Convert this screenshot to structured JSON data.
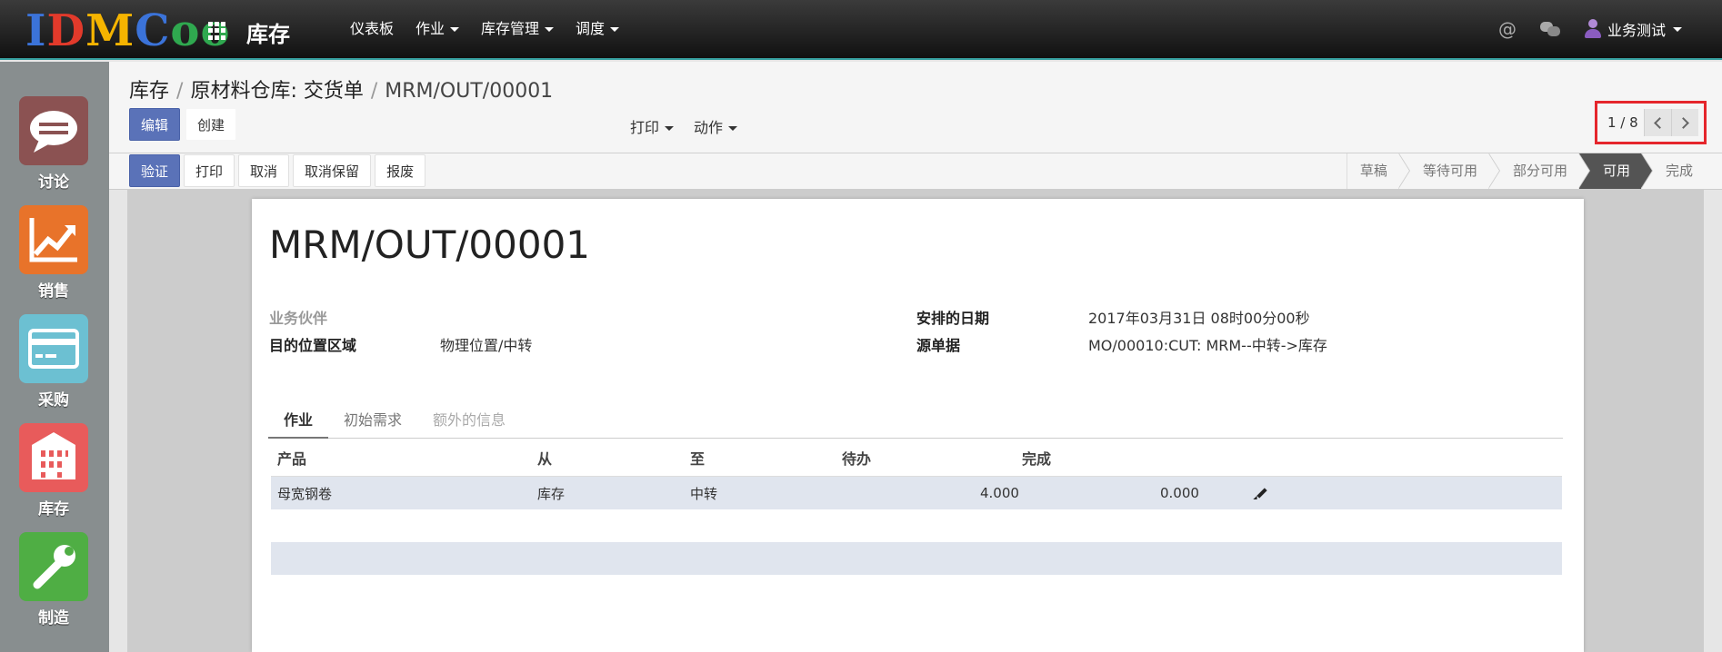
{
  "navbar": {
    "logo": [
      "I",
      "D",
      "M",
      "C",
      "o",
      "o"
    ],
    "logo_colors": [
      "#3b73d9",
      "#e23a2b",
      "#f5b400",
      "#3b73d9",
      "#2fa84f",
      "#2fa84f"
    ],
    "app_title": "库存",
    "menu": [
      {
        "label": "仪表板",
        "dropdown": false
      },
      {
        "label": "作业",
        "dropdown": true
      },
      {
        "label": "库存管理",
        "dropdown": true
      },
      {
        "label": "调度",
        "dropdown": true
      }
    ],
    "at_symbol": "@",
    "user_name": "业务测试"
  },
  "sidebar": {
    "apps": [
      {
        "label": "讨论",
        "color": "#8b5252",
        "icon": "chat-bubble-icon"
      },
      {
        "label": "销售",
        "color": "#e8732a",
        "icon": "trending-up-chart-icon"
      },
      {
        "label": "采购",
        "color": "#6cc0d2",
        "icon": "credit-card-icon"
      },
      {
        "label": "库存",
        "color": "#e85b5b",
        "icon": "building-icon"
      },
      {
        "label": "制造",
        "color": "#4fae44",
        "icon": "wrench-icon"
      }
    ]
  },
  "breadcrumb": {
    "items": [
      "库存",
      "原材料仓库: 交货单"
    ],
    "current": "MRM/OUT/00001"
  },
  "control": {
    "edit_label": "编辑",
    "create_label": "创建",
    "print_label": "打印",
    "action_label": "动作",
    "pager_value": "1 / 8"
  },
  "statusbar": {
    "buttons": [
      "验证",
      "打印",
      "取消",
      "取消保留",
      "报废"
    ],
    "stages": [
      "草稿",
      "等待可用",
      "部分可用",
      "可用",
      "完成"
    ],
    "current_stage": "可用"
  },
  "form": {
    "title": "MRM/OUT/00001",
    "partner_label": "业务伙伴",
    "partner_value": "",
    "dest_label": "目的位置区域",
    "dest_value": "物理位置/中转",
    "scheduled_label": "安排的日期",
    "scheduled_value": "2017年03月31日 08时00分00秒",
    "origin_label": "源单据",
    "origin_value": "MO/00010:CUT: MRM--中转->库存",
    "tabs": [
      "作业",
      "初始需求",
      "额外的信息"
    ],
    "active_tab": "作业"
  },
  "table": {
    "columns": [
      "产品",
      "从",
      "至",
      "待办",
      "完成"
    ],
    "rows": [
      {
        "product": "母宽钢卷",
        "from": "库存",
        "to": "中转",
        "todo": "4.000",
        "done": "0.000"
      }
    ]
  }
}
